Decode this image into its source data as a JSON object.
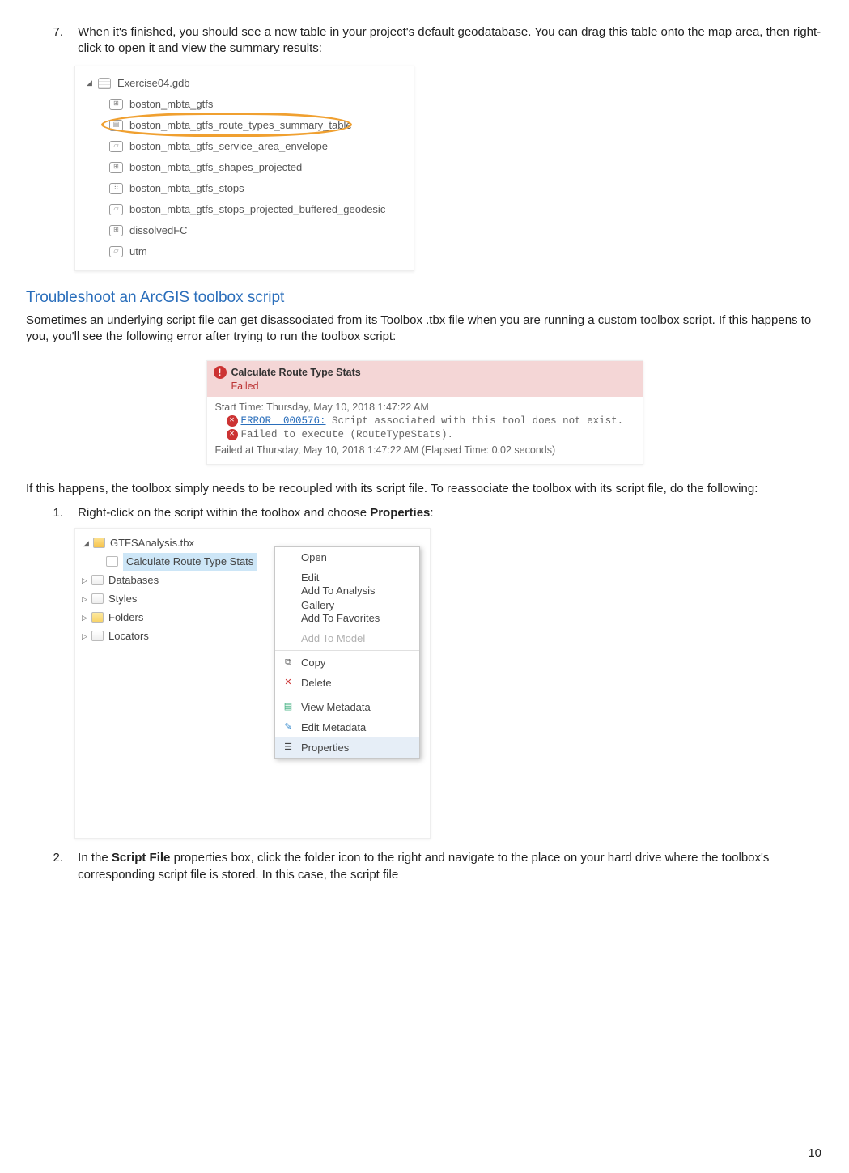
{
  "step7": {
    "num": "7.",
    "text": "When it's finished, you should see a new table in your project's default geodatabase.  You can drag this table onto the map area, then right-click to open it and view the summary results:"
  },
  "catalog": {
    "gdb": "Exercise04.gdb",
    "items": [
      "boston_mbta_gtfs",
      "boston_mbta_gtfs_route_types_summary_table",
      "boston_mbta_gtfs_service_area_envelope",
      "boston_mbta_gtfs_shapes_projected",
      "boston_mbta_gtfs_stops",
      "boston_mbta_gtfs_stops_projected_buffered_geodesic",
      "dissolvedFC",
      "utm"
    ]
  },
  "section_heading": "Troubleshoot an ArcGIS toolbox script",
  "para1": "Sometimes an underlying script file can get disassociated from its Toolbox .tbx file when you are running a custom toolbox script. If this happens to you, you'll see the following error after trying to run the toolbox script:",
  "error": {
    "title": "Calculate Route Type Stats",
    "status": "Failed",
    "start": "Start Time: Thursday, May 10, 2018 1:47:22 AM",
    "err_code": "ERROR  000576:",
    "err_msg": " Script associated with this tool does not exist.",
    "fail_line": "Failed to execute (RouteTypeStats).",
    "end": "Failed at Thursday, May 10, 2018 1:47:22 AM (Elapsed Time: 0.02 seconds)"
  },
  "para2": "If this happens, the toolbox simply needs to be recoupled with its script file. To reassociate the toolbox with its script file, do the following:",
  "step1": {
    "num": "1.",
    "pre": "Right-click on the script within the toolbox and choose ",
    "bold": "Properties",
    "post": ":"
  },
  "tree": {
    "tbx": "GTFSAnalysis.tbx",
    "script": "Calculate Route Type Stats",
    "nodes": [
      "Databases",
      "Styles",
      "Folders",
      "Locators"
    ]
  },
  "menu": {
    "items": [
      "Open",
      "Edit",
      "Add To Analysis Gallery",
      "Add To Favorites",
      "Add To Model",
      "Copy",
      "Delete",
      "View Metadata",
      "Edit Metadata",
      "Properties"
    ]
  },
  "step2": {
    "num": "2.",
    "pre": "In the ",
    "bold": "Script File",
    "post": " properties box, click the folder icon to the right and navigate to the place on your hard drive where the toolbox's corresponding script file is stored. In this case, the script file"
  },
  "page_number": "10"
}
